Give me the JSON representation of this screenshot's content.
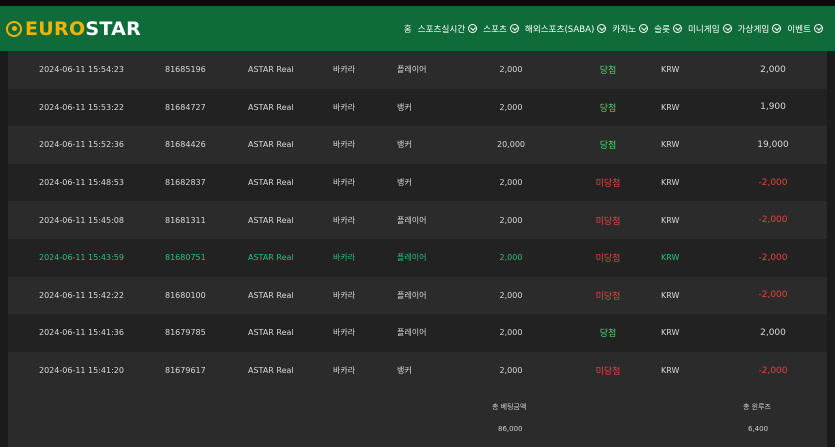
{
  "brand": {
    "logo_part1": "EURO",
    "logo_part2": "STAR",
    "accent": "#f2b300",
    "nav_bg": "#0f6b3a"
  },
  "nav": [
    {
      "label": "홈",
      "chevron": false
    },
    {
      "label": "스포츠실시간",
      "chevron": true
    },
    {
      "label": "스포츠",
      "chevron": true
    },
    {
      "label": "해외스포츠(SABA)",
      "chevron": true
    },
    {
      "label": "카지노",
      "chevron": true
    },
    {
      "label": "슬롯",
      "chevron": true
    },
    {
      "label": "미니게임",
      "chevron": true
    },
    {
      "label": "가상게임",
      "chevron": true
    },
    {
      "label": "이벤트",
      "chevron": true
    }
  ],
  "rows": [
    {
      "time": "2024-06-11 15:54:23",
      "id": "81685196",
      "provider": "ASTAR Real",
      "game": "바카라",
      "pick": "플레이어",
      "bet": "2,000",
      "result": "당첨",
      "currency": "KRW",
      "amount": "2,000"
    },
    {
      "time": "2024-06-11 15:53:22",
      "id": "81684727",
      "provider": "ASTAR Real",
      "game": "바카라",
      "pick": "뱅커",
      "bet": "2,000",
      "result": "당첨",
      "currency": "KRW",
      "amount": "1,900"
    },
    {
      "time": "2024-06-11 15:52:36",
      "id": "81684426",
      "provider": "ASTAR Real",
      "game": "바카라",
      "pick": "뱅커",
      "bet": "20,000",
      "result": "당첨",
      "currency": "KRW",
      "amount": "19,000"
    },
    {
      "time": "2024-06-11 15:48:53",
      "id": "81682837",
      "provider": "ASTAR Real",
      "game": "바카라",
      "pick": "뱅커",
      "bet": "2,000",
      "result": "미당첨",
      "currency": "KRW",
      "amount": "-2,000"
    },
    {
      "time": "2024-06-11 15:45:08",
      "id": "81681311",
      "provider": "ASTAR Real",
      "game": "바카라",
      "pick": "플레이어",
      "bet": "2,000",
      "result": "미당첨",
      "currency": "KRW",
      "amount": "-2,000"
    },
    {
      "time": "2024-06-11 15:43:59",
      "id": "81680751",
      "provider": "ASTAR Real",
      "game": "바카라",
      "pick": "플레이어",
      "bet": "2,000",
      "result": "미당첨",
      "currency": "KRW",
      "amount": "-2,000",
      "highlight": true
    },
    {
      "time": "2024-06-11 15:42:22",
      "id": "81680100",
      "provider": "ASTAR Real",
      "game": "바카라",
      "pick": "플레이어",
      "bet": "2,000",
      "result": "미당첨",
      "currency": "KRW",
      "amount": "-2,000"
    },
    {
      "time": "2024-06-11 15:41:36",
      "id": "81679785",
      "provider": "ASTAR Real",
      "game": "바카라",
      "pick": "플레이어",
      "bet": "2,000",
      "result": "당첨",
      "currency": "KRW",
      "amount": "2,000"
    },
    {
      "time": "2024-06-11 15:41:20",
      "id": "81679617",
      "provider": "ASTAR Real",
      "game": "바카라",
      "pick": "뱅커",
      "bet": "2,000",
      "result": "미당첨",
      "currency": "KRW",
      "amount": "-2,000"
    }
  ],
  "summary": {
    "total_bet_label": "총 베팅금액",
    "total_bet_value": "86,000",
    "total_winloss_label": "총 윈루즈",
    "total_winloss_value": "6,400"
  },
  "colors": {
    "win": "#4ed76e",
    "lose": "#e8433f",
    "highlight_text": "#27c27a"
  }
}
